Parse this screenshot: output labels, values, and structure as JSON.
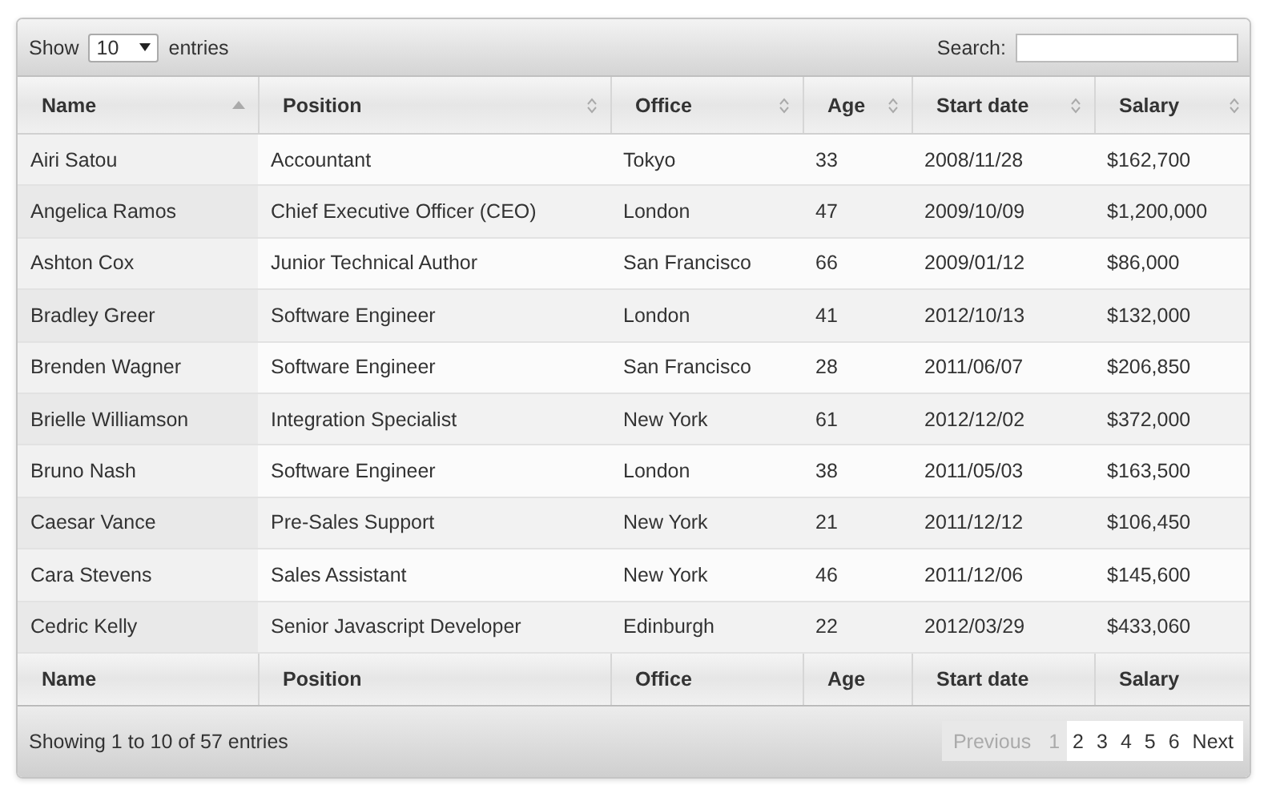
{
  "length_menu": {
    "label_before": "Show",
    "value": "10",
    "label_after": "entries"
  },
  "search": {
    "label": "Search:"
  },
  "columns": [
    {
      "label": "Name",
      "sorted": true
    },
    {
      "label": "Position",
      "sorted": false
    },
    {
      "label": "Office",
      "sorted": false
    },
    {
      "label": "Age",
      "sorted": false
    },
    {
      "label": "Start date",
      "sorted": false
    },
    {
      "label": "Salary",
      "sorted": false
    }
  ],
  "rows": [
    [
      "Airi Satou",
      "Accountant",
      "Tokyo",
      "33",
      "2008/11/28",
      "$162,700"
    ],
    [
      "Angelica Ramos",
      "Chief Executive Officer (CEO)",
      "London",
      "47",
      "2009/10/09",
      "$1,200,000"
    ],
    [
      "Ashton Cox",
      "Junior Technical Author",
      "San Francisco",
      "66",
      "2009/01/12",
      "$86,000"
    ],
    [
      "Bradley Greer",
      "Software Engineer",
      "London",
      "41",
      "2012/10/13",
      "$132,000"
    ],
    [
      "Brenden Wagner",
      "Software Engineer",
      "San Francisco",
      "28",
      "2011/06/07",
      "$206,850"
    ],
    [
      "Brielle Williamson",
      "Integration Specialist",
      "New York",
      "61",
      "2012/12/02",
      "$372,000"
    ],
    [
      "Bruno Nash",
      "Software Engineer",
      "London",
      "38",
      "2011/05/03",
      "$163,500"
    ],
    [
      "Caesar Vance",
      "Pre-Sales Support",
      "New York",
      "21",
      "2011/12/12",
      "$106,450"
    ],
    [
      "Cara Stevens",
      "Sales Assistant",
      "New York",
      "46",
      "2011/12/06",
      "$145,600"
    ],
    [
      "Cedric Kelly",
      "Senior Javascript Developer",
      "Edinburgh",
      "22",
      "2012/03/29",
      "$433,060"
    ]
  ],
  "footer_columns": [
    "Name",
    "Position",
    "Office",
    "Age",
    "Start date",
    "Salary"
  ],
  "info": "Showing 1 to 10 of 57 entries",
  "pagination": {
    "previous": {
      "label": "Previous",
      "disabled": true
    },
    "pages": [
      {
        "label": "1",
        "selected": true
      },
      {
        "label": "2",
        "selected": false
      },
      {
        "label": "3",
        "selected": false
      },
      {
        "label": "4",
        "selected": false
      },
      {
        "label": "5",
        "selected": false
      },
      {
        "label": "6",
        "selected": false
      }
    ],
    "next": {
      "label": "Next",
      "disabled": false
    }
  }
}
